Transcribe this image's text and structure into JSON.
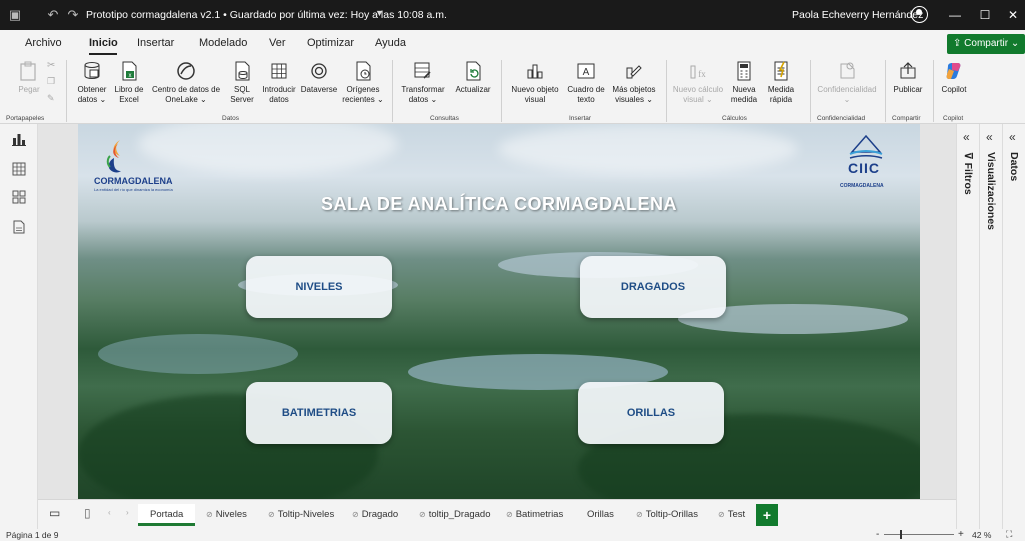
{
  "window": {
    "doc_title": "Prototipo cormagdalena v2.1 • Guardado por última vez: Hoy a las 10:08 a.m.",
    "user": "Paola Echeverry Hernández"
  },
  "menu": {
    "items": [
      "Archivo",
      "Inicio",
      "Insertar",
      "Modelado",
      "Ver",
      "Optimizar",
      "Ayuda"
    ],
    "share": "Compartir"
  },
  "ribbon": {
    "pegar": "Pegar",
    "obtener": "Obtener datos",
    "libro": "Libro de Excel",
    "centro": "Centro de datos de OneLake",
    "sql": "SQL Server",
    "introducir": "Introducir datos",
    "dataverse": "Dataverse",
    "origenes": "Orígenes recientes",
    "transformar": "Transformar datos",
    "actualizar": "Actualizar",
    "nuevo_objeto": "Nuevo objeto visual",
    "cuadro_texto": "Cuadro de texto",
    "mas_objetos": "Más objetos visuales",
    "nuevo_calculo": "Nuevo cálculo visual",
    "nueva_medida": "Nueva medida",
    "medida_rapida": "Medida rápida",
    "confidencialidad": "Confidencialidad",
    "publicar": "Publicar",
    "copilot": "Copilot",
    "groups": {
      "portapapeles": "Portapapeles",
      "datos": "Datos",
      "consultas": "Consultas",
      "insertar": "Insertar",
      "calculos": "Cálculos",
      "confidencialidad": "Confidencialidad",
      "compartir": "Compartir",
      "copilot": "Copilot"
    }
  },
  "report": {
    "title": "SALA DE ANALÍTICA CORMAGDALENA",
    "logo_left": "CORMAGDALENA",
    "logo_left_slogan": "La entidad del río que dinamiza la economía",
    "logo_right": "CIIC",
    "logo_right_sub": "CORMAGDALENA",
    "buttons": {
      "niveles": "NIVELES",
      "dragados": "DRAGADOS",
      "batimetrias": "BATIMETRIAS",
      "orillas": "ORILLAS"
    }
  },
  "panels": {
    "filtros": "Filtros",
    "visualizaciones": "Visualizaciones",
    "datos": "Datos"
  },
  "tabs": [
    "Portada",
    "Niveles",
    "Toltip-Niveles",
    "Dragado",
    "toltip_Dragado",
    "Batimetrias",
    "Orillas",
    "Toltip-Orillas",
    "Test"
  ],
  "status": {
    "page": "Página 1 de 9",
    "zoom": "42 %"
  }
}
